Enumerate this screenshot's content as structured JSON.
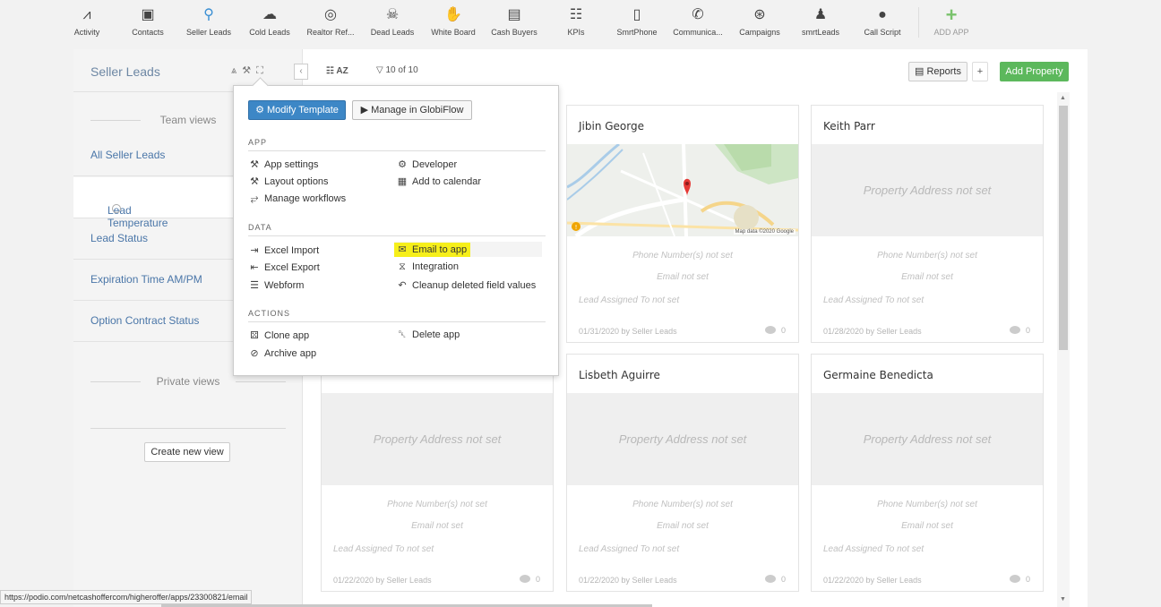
{
  "app_bar": {
    "items": [
      {
        "label": "Activity",
        "icon": "activity-icon",
        "glyph": "⩘"
      },
      {
        "label": "Contacts",
        "icon": "contacts-icon",
        "glyph": "▣"
      },
      {
        "label": "Seller Leads",
        "icon": "key-icon",
        "glyph": "⚲"
      },
      {
        "label": "Cold Leads",
        "icon": "cold-leads-icon",
        "glyph": "☁"
      },
      {
        "label": "Realtor Ref...",
        "icon": "broadcast-icon",
        "glyph": "◎"
      },
      {
        "label": "Dead Leads",
        "icon": "skull-icon",
        "glyph": "☠"
      },
      {
        "label": "White Board",
        "icon": "handshake-icon",
        "glyph": "✋"
      },
      {
        "label": "Cash Buyers",
        "icon": "cash-icon",
        "glyph": "▤"
      },
      {
        "label": "KPIs",
        "icon": "book-icon",
        "glyph": "☷"
      },
      {
        "label": "SmrtPhone",
        "icon": "phone-icon",
        "glyph": "▯"
      },
      {
        "label": "Communica...",
        "icon": "call-icon",
        "glyph": "✆"
      },
      {
        "label": "Campaigns",
        "icon": "target-icon",
        "glyph": "⊛"
      },
      {
        "label": "smrtLeads",
        "icon": "user-icon",
        "glyph": "♟"
      },
      {
        "label": "Call Script",
        "icon": "chat-icon",
        "glyph": "●"
      },
      {
        "label": "ADD APP",
        "icon": "plus-icon",
        "glyph": "+"
      }
    ]
  },
  "sidebar": {
    "title": "Seller Leads",
    "team_views_label": "Team views",
    "views": [
      "All Seller Leads",
      "Lead Temperature",
      "Lead Status",
      "Expiration Time AM/PM",
      "Option Contract Status"
    ],
    "private_views_label": "Private views",
    "create_view_label": "Create new view"
  },
  "toolbar": {
    "sort_label": "AZ",
    "filter_count": "10 of 10",
    "reports_label": "Reports",
    "plus_label": "+",
    "add_label": "Add Property"
  },
  "dropdown": {
    "modify_label": "Modify Template",
    "globiflow_label": "Manage in GlobiFlow",
    "app_heading": "APP",
    "app_items_left": [
      "App settings",
      "Layout options",
      "Manage workflows"
    ],
    "app_items_right": [
      "Developer",
      "Add to calendar"
    ],
    "data_heading": "DATA",
    "data_items_left": [
      "Excel Import",
      "Excel Export",
      "Webform"
    ],
    "data_items_right": [
      "Email to app",
      "Integration",
      "Cleanup deleted field values"
    ],
    "actions_heading": "ACTIONS",
    "actions_items_left": [
      "Clone app",
      "Archive app"
    ],
    "actions_items_right": [
      "Delete app"
    ]
  },
  "cards": [
    {
      "name": "Jibin George",
      "address": "",
      "has_map": true,
      "map_credit": "Map data ©2020 Google",
      "phone": "Phone Number(s) not set",
      "email": "Email not set",
      "lead": "Lead Assigned To not set",
      "footer": "01/31/2020 by Seller Leads",
      "comments": "0"
    },
    {
      "name": "Keith Parr",
      "address": "Property Address not set",
      "has_map": false,
      "phone": "Phone Number(s) not set",
      "email": "Email not set",
      "lead": "Lead Assigned To not set",
      "footer": "01/28/2020 by Seller Leads",
      "comments": "0"
    },
    {
      "name": "",
      "address": "Property Address not set",
      "has_map": false,
      "phone": "Phone Number(s) not set",
      "email": "Email not set",
      "lead": "Lead Assigned To not set",
      "footer": "01/22/2020 by Seller Leads",
      "comments": "0"
    },
    {
      "name": "Lisbeth Aguirre",
      "address": "Property Address not set",
      "has_map": false,
      "phone": "Phone Number(s) not set",
      "email": "Email not set",
      "lead": "Lead Assigned To not set",
      "footer": "01/22/2020 by Seller Leads",
      "comments": "0"
    },
    {
      "name": "Germaine Benedicta",
      "address": "Property Address not set",
      "has_map": false,
      "phone": "Phone Number(s) not set",
      "email": "Email not set",
      "lead": "Lead Assigned To not set",
      "footer": "01/22/2020 by Seller Leads",
      "comments": "0"
    }
  ],
  "status_bar": {
    "url": "https://podio.com/netcashoffercom/higheroffer/apps/23300821/email"
  },
  "colors": {
    "accent_blue": "#3d87c6",
    "add_green": "#5cb85c",
    "highlight_yellow": "#f6ef1a",
    "link_blue": "#4a76a8"
  }
}
